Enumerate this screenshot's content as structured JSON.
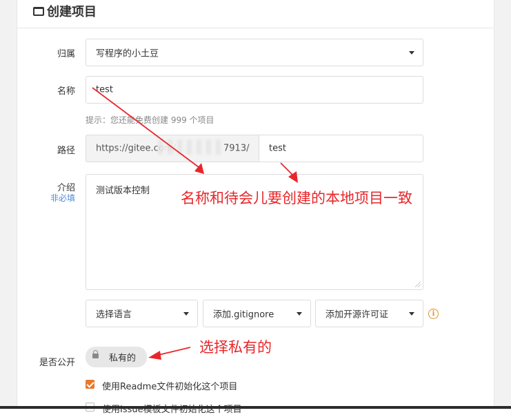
{
  "page": {
    "title": "创建项目"
  },
  "form": {
    "owner": {
      "label": "归属",
      "value": "写程序的小土豆"
    },
    "name": {
      "label": "名称",
      "value": "test",
      "hint": "提示：您还能免费创建 999 个项目"
    },
    "path": {
      "label": "路径",
      "prefix": "https://gitee.com/",
      "prefix_tail": "7913/",
      "value": "test"
    },
    "intro": {
      "label": "介绍",
      "sub_label": "非必填",
      "value": "测试版本控制"
    },
    "language_select": {
      "value": "选择语言"
    },
    "gitignore_select": {
      "value": "添加.gitignore"
    },
    "license_select": {
      "value": "添加开源许可证"
    },
    "visibility": {
      "label": "是否公开",
      "value": "私有的"
    },
    "readme_checkbox": {
      "label": "使用Readme文件初始化这个项目",
      "checked": true
    },
    "template_checkbox": {
      "label": "使用Issue模板文件初始化这个项目",
      "checked": false
    }
  },
  "annotations": {
    "name_note": "名称和待会儿要创建的本地项目一致",
    "private_note": "选择私有的",
    "color": "#e8262a"
  },
  "icons": {
    "info": "info-icon",
    "lock": "lock-icon",
    "folder": "folder-icon"
  },
  "colors": {
    "accent": "#e8792c",
    "hint": "#888888",
    "sub_label": "#4a8bd6"
  }
}
